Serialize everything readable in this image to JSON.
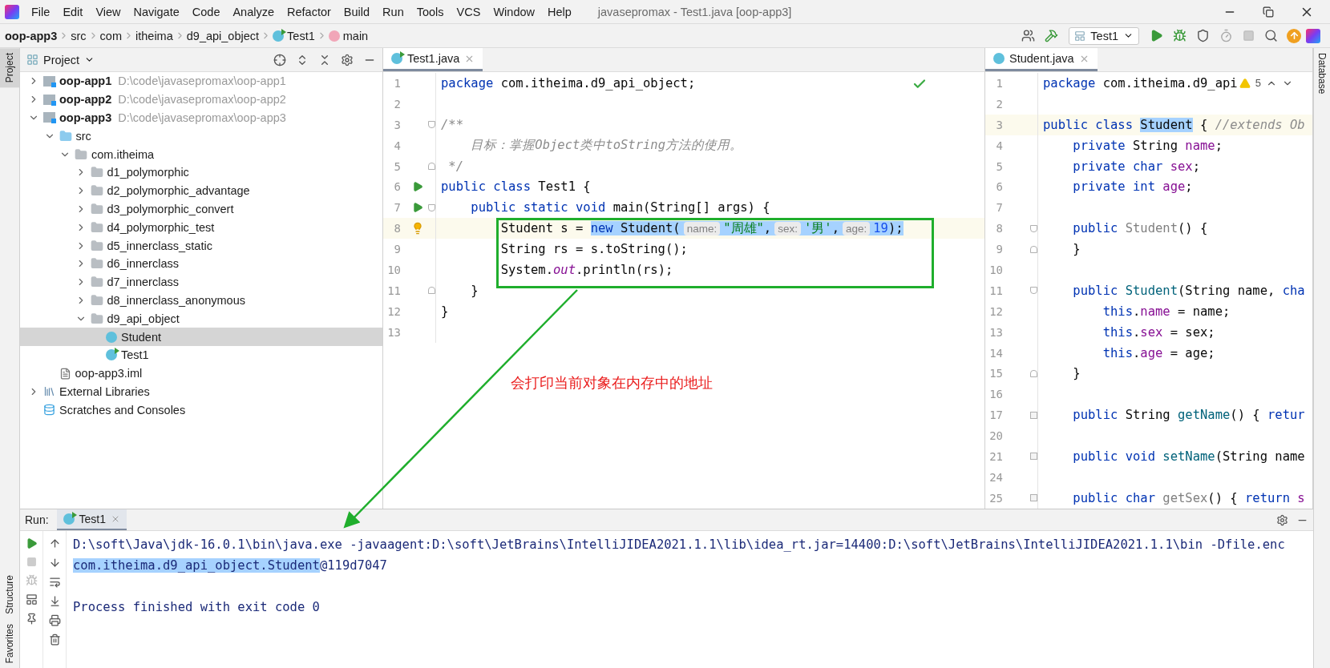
{
  "menu": [
    "File",
    "Edit",
    "View",
    "Navigate",
    "Code",
    "Analyze",
    "Refactor",
    "Build",
    "Run",
    "Tools",
    "VCS",
    "Window",
    "Help"
  ],
  "window_title": "javasepromax - Test1.java [oop-app3]",
  "breadcrumbs": [
    {
      "label": "oop-app3",
      "kind": "project"
    },
    {
      "label": "src",
      "kind": "folder"
    },
    {
      "label": "com",
      "kind": "folder"
    },
    {
      "label": "itheima",
      "kind": "folder"
    },
    {
      "label": "d9_api_object",
      "kind": "folder"
    },
    {
      "label": "Test1",
      "kind": "class"
    },
    {
      "label": "main",
      "kind": "method"
    }
  ],
  "toolbar": {
    "run_config": "Test1"
  },
  "stripes": {
    "left_top": [
      {
        "label": "Project",
        "selected": true
      }
    ],
    "left_bottom": [
      {
        "label": "Structure",
        "selected": false
      },
      {
        "label": "Favorites",
        "selected": false
      }
    ],
    "right": [
      {
        "label": "Database",
        "selected": false
      }
    ]
  },
  "project_panel": {
    "title": "Project",
    "tree": [
      {
        "label": "oop-app1",
        "path": "D:\\code\\javasepromax\\oop-app1",
        "kind": "module",
        "expanded": false,
        "selected": false
      },
      {
        "label": "oop-app2",
        "path": "D:\\code\\javasepromax\\oop-app2",
        "kind": "module",
        "expanded": false,
        "selected": false
      },
      {
        "label": "oop-app3",
        "path": "D:\\code\\javasepromax\\oop-app3",
        "kind": "module",
        "expanded": true,
        "selected": false,
        "children": [
          {
            "label": "src",
            "kind": "source",
            "expanded": true,
            "selected": false,
            "children": [
              {
                "label": "com.itheima",
                "kind": "package",
                "expanded": true,
                "selected": false,
                "children": [
                  {
                    "label": "d1_polymorphic",
                    "kind": "package",
                    "expanded": false,
                    "selected": false
                  },
                  {
                    "label": "d2_polymorphic_advantage",
                    "kind": "package",
                    "expanded": false,
                    "selected": false
                  },
                  {
                    "label": "d3_polymorphic_convert",
                    "kind": "package",
                    "expanded": false,
                    "selected": false
                  },
                  {
                    "label": "d4_polymorphic_test",
                    "kind": "package",
                    "expanded": false,
                    "selected": false
                  },
                  {
                    "label": "d5_innerclass_static",
                    "kind": "package",
                    "expanded": false,
                    "selected": false
                  },
                  {
                    "label": "d6_innerclass",
                    "kind": "package",
                    "expanded": false,
                    "selected": false
                  },
                  {
                    "label": "d7_innerclass",
                    "kind": "package",
                    "expanded": false,
                    "selected": false
                  },
                  {
                    "label": "d8_innerclass_anonymous",
                    "kind": "package",
                    "expanded": false,
                    "selected": false
                  },
                  {
                    "label": "d9_api_object",
                    "kind": "package",
                    "expanded": true,
                    "selected": false,
                    "children": [
                      {
                        "label": "Student",
                        "kind": "class",
                        "selected": true
                      },
                      {
                        "label": "Test1",
                        "kind": "runnable",
                        "selected": false
                      }
                    ]
                  }
                ]
              }
            ]
          },
          {
            "label": "oop-app3.iml",
            "kind": "file",
            "selected": false
          }
        ]
      },
      {
        "label": "External Libraries",
        "kind": "libraries",
        "expanded": false,
        "selected": false
      },
      {
        "label": "Scratches and Consoles",
        "kind": "scratches",
        "selected": false
      }
    ]
  },
  "editors": [
    {
      "tab": {
        "label": "Test1.java",
        "kind": "runnable"
      },
      "inspection": {
        "kind": "ok"
      },
      "lines": [
        {
          "n": "1",
          "current": false,
          "tokens": [
            {
              "kind": "kw",
              "text": "package"
            },
            {
              "kind": "plain",
              "text": " com.itheima.d9_api_object;"
            }
          ]
        },
        {
          "n": "2",
          "current": false
        },
        {
          "n": "3",
          "current": false,
          "gutter": [
            {
              "kind": "fold-start"
            }
          ],
          "tokens": [
            {
              "kind": "doc",
              "text": "/**"
            }
          ]
        },
        {
          "n": "4",
          "current": false,
          "tokens": [
            {
              "kind": "doc",
              "text": "    目标：掌握Object类中toString方法的使用。"
            }
          ]
        },
        {
          "n": "5",
          "current": false,
          "gutter": [
            {
              "kind": "fold-end"
            }
          ],
          "tokens": [
            {
              "kind": "doc",
              "text": " */"
            }
          ]
        },
        {
          "n": "6",
          "current": false,
          "gutter": [
            {
              "kind": "run"
            }
          ],
          "tokens": [
            {
              "kind": "kw",
              "text": "public class"
            },
            {
              "kind": "plain",
              "text": " Test1 {"
            }
          ]
        },
        {
          "n": "7",
          "current": false,
          "gutter": [
            {
              "kind": "run"
            },
            {
              "kind": "fold-start"
            }
          ],
          "tokens": [
            {
              "kind": "kw",
              "text": "    public static void"
            },
            {
              "kind": "plain",
              "text": " main(String[] args) {"
            }
          ]
        },
        {
          "n": "8",
          "current": true,
          "gutter": [
            {
              "kind": "bulb"
            }
          ],
          "tokens": [
            {
              "kind": "plain",
              "text": "        Student s = "
            },
            {
              "kind": "selection",
              "tokens": [
                {
                  "kind": "kw",
                  "text": "new"
                },
                {
                  "kind": "plain",
                  "text": " Student("
                },
                {
                  "kind": "hint",
                  "text": "name:"
                },
                {
                  "kind": "string",
                  "text": "\"周雄\""
                },
                {
                  "kind": "plain",
                  "text": ","
                },
                {
                  "kind": "hint",
                  "text": "sex:"
                },
                {
                  "kind": "string",
                  "text": "'男'"
                },
                {
                  "kind": "plain",
                  "text": ","
                },
                {
                  "kind": "hint",
                  "text": "age:"
                },
                {
                  "kind": "number",
                  "text": "19"
                },
                {
                  "kind": "plain",
                  "text": ");"
                }
              ]
            }
          ]
        },
        {
          "n": "9",
          "current": false,
          "tokens": [
            {
              "kind": "plain",
              "text": "        String rs = s.toString();"
            }
          ]
        },
        {
          "n": "10",
          "current": false,
          "tokens": [
            {
              "kind": "plain",
              "text": "        System."
            },
            {
              "kind": "static",
              "text": "out"
            },
            {
              "kind": "plain",
              "text": ".println(rs);"
            }
          ]
        },
        {
          "n": "11",
          "current": false,
          "gutter": [
            {
              "kind": "fold-end"
            }
          ],
          "tokens": [
            {
              "kind": "plain",
              "text": "    }"
            }
          ]
        },
        {
          "n": "12",
          "current": false,
          "tokens": [
            {
              "kind": "plain",
              "text": "}"
            }
          ]
        },
        {
          "n": "13",
          "current": false
        }
      ]
    },
    {
      "tab": {
        "label": "Student.java",
        "kind": "class"
      },
      "inspection": {
        "kind": "warnings",
        "count": "5"
      },
      "lines": [
        {
          "n": "1",
          "current": false,
          "tokens": [
            {
              "kind": "kw",
              "text": "package"
            },
            {
              "kind": "plain",
              "text": " com.itheima.d9_api"
            }
          ]
        },
        {
          "n": "2",
          "current": false
        },
        {
          "n": "3",
          "current": true,
          "tokens": [
            {
              "kind": "kw",
              "text": "public class "
            },
            {
              "kind": "selection",
              "tokens": [
                {
                  "kind": "plain",
                  "text": "Student"
                }
              ]
            },
            {
              "kind": "plain",
              "text": " { "
            },
            {
              "kind": "comment",
              "text": "//extends Ob"
            }
          ]
        },
        {
          "n": "4",
          "current": false,
          "tokens": [
            {
              "kind": "kw",
              "text": "    private"
            },
            {
              "kind": "plain",
              "text": " String "
            },
            {
              "kind": "field",
              "text": "name"
            },
            {
              "kind": "plain",
              "text": ";"
            }
          ]
        },
        {
          "n": "5",
          "current": false,
          "tokens": [
            {
              "kind": "kw",
              "text": "    private char "
            },
            {
              "kind": "field",
              "text": "sex"
            },
            {
              "kind": "plain",
              "text": ";"
            }
          ]
        },
        {
          "n": "6",
          "current": false,
          "tokens": [
            {
              "kind": "kw",
              "text": "    private int "
            },
            {
              "kind": "field",
              "text": "age"
            },
            {
              "kind": "plain",
              "text": ";"
            }
          ]
        },
        {
          "n": "7",
          "current": false
        },
        {
          "n": "8",
          "current": false,
          "gutter": [
            {
              "kind": "fold-start"
            }
          ],
          "tokens": [
            {
              "kind": "kw",
              "text": "    public "
            },
            {
              "kind": "unused",
              "text": "Student"
            },
            {
              "kind": "plain",
              "text": "() {"
            }
          ]
        },
        {
          "n": "9",
          "current": false,
          "gutter": [
            {
              "kind": "fold-end"
            }
          ],
          "tokens": [
            {
              "kind": "plain",
              "text": "    }"
            }
          ]
        },
        {
          "n": "10",
          "current": false
        },
        {
          "n": "11",
          "current": false,
          "gutter": [
            {
              "kind": "fold-start"
            }
          ],
          "tokens": [
            {
              "kind": "kw",
              "text": "    public "
            },
            {
              "kind": "method",
              "text": "Student"
            },
            {
              "kind": "plain",
              "text": "(String name, "
            },
            {
              "kind": "kw",
              "text": "cha"
            }
          ]
        },
        {
          "n": "12",
          "current": false,
          "tokens": [
            {
              "kind": "kw",
              "text": "        this"
            },
            {
              "kind": "plain",
              "text": "."
            },
            {
              "kind": "field",
              "text": "name"
            },
            {
              "kind": "plain",
              "text": " = name;"
            }
          ]
        },
        {
          "n": "13",
          "current": false,
          "tokens": [
            {
              "kind": "kw",
              "text": "        this"
            },
            {
              "kind": "plain",
              "text": "."
            },
            {
              "kind": "field",
              "text": "sex"
            },
            {
              "kind": "plain",
              "text": " = sex;"
            }
          ]
        },
        {
          "n": "14",
          "current": false,
          "tokens": [
            {
              "kind": "kw",
              "text": "        this"
            },
            {
              "kind": "plain",
              "text": "."
            },
            {
              "kind": "field",
              "text": "age"
            },
            {
              "kind": "plain",
              "text": " = age;"
            }
          ]
        },
        {
          "n": "15",
          "current": false,
          "gutter": [
            {
              "kind": "fold-end"
            }
          ],
          "tokens": [
            {
              "kind": "plain",
              "text": "    }"
            }
          ]
        },
        {
          "n": "16",
          "current": false
        },
        {
          "n": "17",
          "current": false,
          "gutter": [
            {
              "kind": "fold-collapsed"
            }
          ],
          "tokens": [
            {
              "kind": "kw",
              "text": "    public "
            },
            {
              "kind": "plain",
              "text": "String "
            },
            {
              "kind": "method",
              "text": "getName"
            },
            {
              "kind": "plain",
              "text": "() { "
            },
            {
              "kind": "kw",
              "text": "retur"
            }
          ]
        },
        {
          "n": "20",
          "current": false
        },
        {
          "n": "21",
          "current": false,
          "gutter": [
            {
              "kind": "fold-collapsed"
            }
          ],
          "tokens": [
            {
              "kind": "kw",
              "text": "    public void "
            },
            {
              "kind": "method",
              "text": "setName"
            },
            {
              "kind": "plain",
              "text": "(String name"
            }
          ]
        },
        {
          "n": "24",
          "current": false
        },
        {
          "n": "25",
          "current": false,
          "gutter": [
            {
              "kind": "fold-collapsed"
            }
          ],
          "tokens": [
            {
              "kind": "kw",
              "text": "    public char "
            },
            {
              "kind": "unused",
              "text": "getSex"
            },
            {
              "kind": "plain",
              "text": "() { "
            },
            {
              "kind": "kw",
              "text": "return "
            },
            {
              "kind": "field",
              "text": "s"
            }
          ]
        }
      ]
    }
  ],
  "annotation": {
    "text": "会打印当前对象在内存中的地址"
  },
  "run_panel": {
    "label": "Run:",
    "tab": "Test1",
    "console": [
      {
        "kind": "text",
        "tokens": [
          {
            "kind": "plain",
            "text": "D:\\soft\\Java\\jdk-16.0.1\\bin\\java.exe -javaagent:D:\\soft\\JetBrains\\IntelliJIDEA2021.1.1\\lib\\idea_rt.jar=14400:D:\\soft\\JetBrains\\IntelliJIDEA2021.1.1\\bin -Dfile.enc"
          }
        ]
      },
      {
        "kind": "text",
        "tokens": [
          {
            "kind": "selection",
            "tokens": [
              {
                "kind": "plain",
                "text": "com.itheima.d9_api_object.Student"
              }
            ]
          },
          {
            "kind": "plain",
            "text": "@119d7047"
          }
        ]
      },
      {
        "kind": "blank"
      },
      {
        "kind": "text",
        "tokens": [
          {
            "kind": "plain",
            "text": "Process finished with exit code 0"
          }
        ]
      }
    ]
  }
}
